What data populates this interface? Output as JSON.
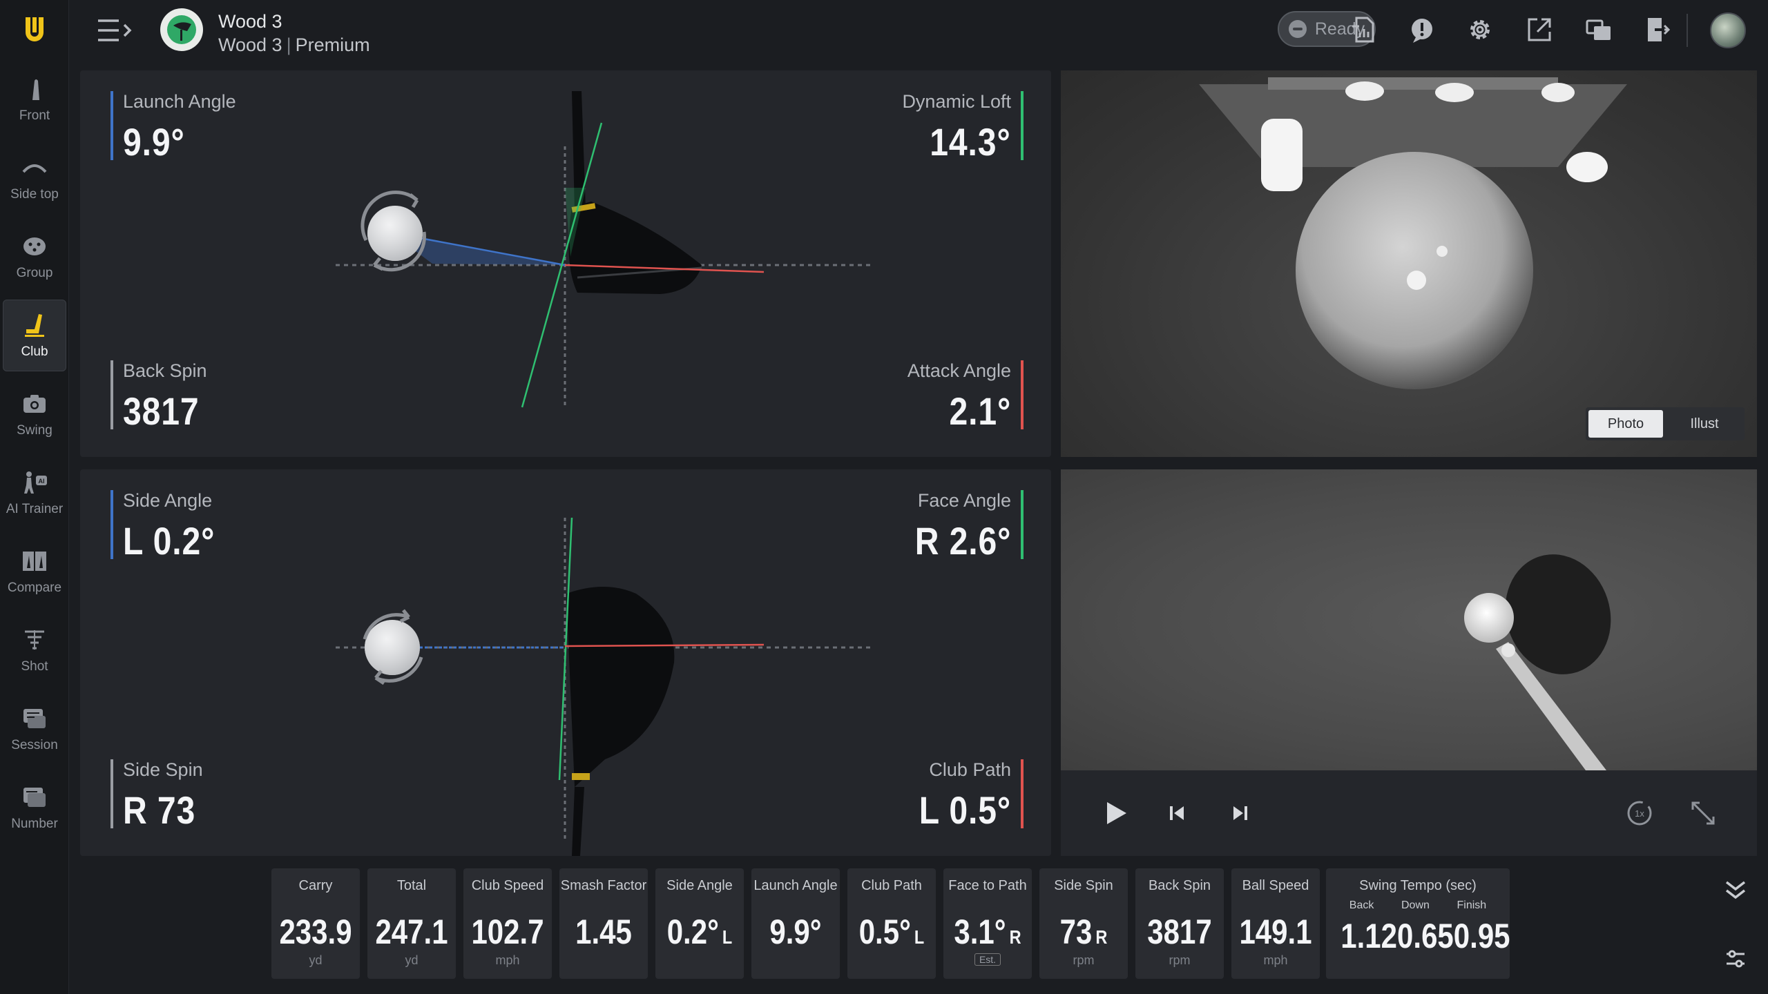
{
  "sidebar": {
    "items": [
      {
        "label": "Front",
        "icon": "front-icon"
      },
      {
        "label": "Side top",
        "icon": "side-top-icon"
      },
      {
        "label": "Group",
        "icon": "group-icon"
      },
      {
        "label": "Club",
        "icon": "club-icon",
        "active": true
      },
      {
        "label": "Swing",
        "icon": "camera-icon"
      },
      {
        "label": "AI Trainer",
        "icon": "ai-trainer-icon"
      },
      {
        "label": "Compare",
        "icon": "compare-icon"
      },
      {
        "label": "Shot",
        "icon": "shot-icon"
      },
      {
        "label": "Session",
        "icon": "session-icon"
      },
      {
        "label": "Number",
        "icon": "number-icon"
      }
    ]
  },
  "header": {
    "club_name": "Wood 3",
    "club_model": "Wood 3",
    "club_tier": "Premium",
    "status": "Ready"
  },
  "top_panel": {
    "launch_angle": {
      "label": "Launch Angle",
      "value": "9.9°"
    },
    "dynamic_loft": {
      "label": "Dynamic Loft",
      "value": "14.3°"
    },
    "back_spin": {
      "label": "Back Spin",
      "value": "3817"
    },
    "attack_angle": {
      "label": "Attack Angle",
      "value": "2.1°"
    }
  },
  "bottom_panel": {
    "side_angle": {
      "label": "Side Angle",
      "value": "L 0.2°"
    },
    "face_angle": {
      "label": "Face Angle",
      "value": "R 2.6°"
    },
    "side_spin": {
      "label": "Side Spin",
      "value": "R 73"
    },
    "club_path": {
      "label": "Club Path",
      "value": "L 0.5°"
    }
  },
  "image_toggle": {
    "photo": "Photo",
    "illust": "Illust",
    "selected": "Photo"
  },
  "stats": [
    {
      "label": "Carry",
      "value": "233.9",
      "suffix": "",
      "unit": "yd"
    },
    {
      "label": "Total",
      "value": "247.1",
      "suffix": "",
      "unit": "yd"
    },
    {
      "label": "Club Speed",
      "value": "102.7",
      "suffix": "",
      "unit": "mph"
    },
    {
      "label": "Smash Factor",
      "value": "1.45",
      "suffix": "",
      "unit": ""
    },
    {
      "label": "Side Angle",
      "value": "0.2°",
      "suffix": "L",
      "unit": ""
    },
    {
      "label": "Launch Angle",
      "value": "9.9°",
      "suffix": "",
      "unit": ""
    },
    {
      "label": "Club Path",
      "value": "0.5°",
      "suffix": "L",
      "unit": ""
    },
    {
      "label": "Face to Path",
      "value": "3.1°",
      "suffix": "R",
      "unit": "",
      "est": "Est."
    },
    {
      "label": "Side Spin",
      "value": "73",
      "suffix": "R",
      "unit": "rpm"
    },
    {
      "label": "Back Spin",
      "value": "3817",
      "suffix": "",
      "unit": "rpm"
    },
    {
      "label": "Ball Speed",
      "value": "149.1",
      "suffix": "",
      "unit": "mph"
    }
  ],
  "tempo": {
    "title": "Swing Tempo (sec)",
    "back_label": "Back",
    "down_label": "Down",
    "finish_label": "Finish",
    "back": "1.12",
    "down": "0.65",
    "finish": "0.95"
  },
  "colors": {
    "blue": "#3f74c9",
    "green": "#2fbf71",
    "red": "#e0534f",
    "accent": "#f0c419"
  }
}
